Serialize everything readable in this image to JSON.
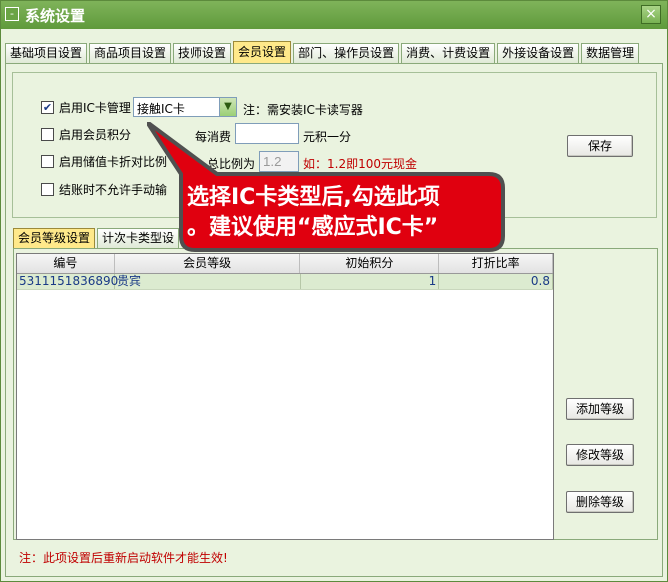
{
  "window": {
    "title": "系统设置",
    "close_label": "×"
  },
  "tabs": [
    {
      "label": "基础项目设置"
    },
    {
      "label": "商品项目设置"
    },
    {
      "label": "技师设置"
    },
    {
      "label": "会员设置"
    },
    {
      "label": "部门、操作员设置"
    },
    {
      "label": "消费、计费设置"
    },
    {
      "label": "外接设备设置"
    },
    {
      "label": "数据管理"
    }
  ],
  "member": {
    "ic_card": {
      "label": "启用IC卡管理",
      "checked": "✔",
      "select_value": "接触IC卡",
      "note": "注：需安装IC卡读写器"
    },
    "points": {
      "label": "启用会员积分",
      "per_spend_label": "每消费",
      "per_spend_value": "",
      "unit_label": "元积一分"
    },
    "discount": {
      "label": "启用储值卡折对比例",
      "ratio_label": "总比例为",
      "ratio_value": "1.2",
      "example": "如：1.2即100元现金"
    },
    "manual": {
      "label": "结账时不允许手动输"
    },
    "save_label": "保存"
  },
  "subtabs": [
    {
      "label": "会员等级设置"
    },
    {
      "label": "计次卡类型设"
    }
  ],
  "grid": {
    "headers": [
      "编号",
      "会员等级",
      "初始积分",
      "打折比率"
    ],
    "rows": [
      {
        "id": "5311151836890",
        "level": "贵宾",
        "points": "1",
        "rate": "0.8"
      }
    ]
  },
  "buttons": {
    "add": "添加等级",
    "edit": "修改等级",
    "delete": "删除等级"
  },
  "footer_note": "注：此项设置后重新启动软件才能生效!",
  "callout": {
    "line1": "选择IC卡类型后,勾选此项",
    "line2": "。建议使用“感应式IC卡”"
  },
  "colors": {
    "accent": "#ffe98a",
    "title_bar": "#6aa445",
    "warning": "#c00000",
    "callout_fill": "#e0000f"
  }
}
